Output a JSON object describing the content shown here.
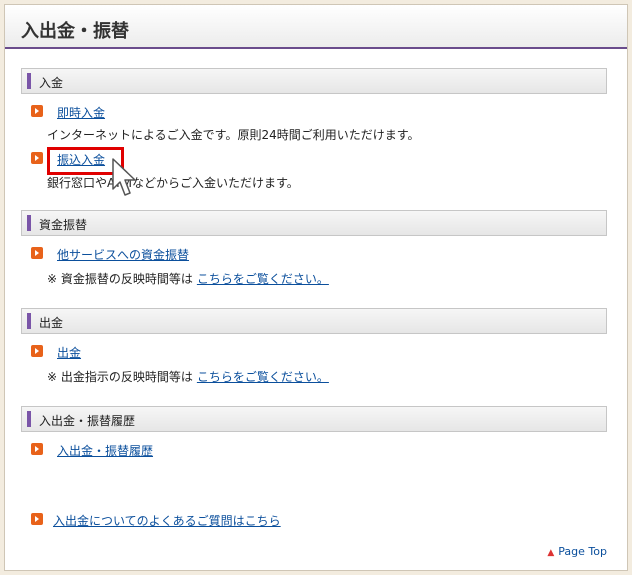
{
  "header": {
    "title": "入出金・振替"
  },
  "sections": [
    {
      "title": "入金"
    },
    {
      "title": "資金振替"
    },
    {
      "title": "出金"
    },
    {
      "title": "入出金・振替履歴"
    }
  ],
  "deposit": {
    "instant_link": "即時入金",
    "instant_desc": "インターネットによるご入金です。原則24時間ご利用いただけます。",
    "transfer_link": "振込入金",
    "transfer_desc": "銀行窓口やATMなどからご入金いただけます。"
  },
  "transfer": {
    "link": "他サービスへの資金振替",
    "note": "※ 資金振替の反映時間等は",
    "note_link": "こちらをご覧ください。"
  },
  "withdraw": {
    "link": "出金",
    "note": "※ 出金指示の反映時間等は",
    "note_link": "こちらをご覧ください。"
  },
  "history": {
    "link": "入出金・振替履歴"
  },
  "faq": {
    "link": "入出金についてのよくあるご質問はこちら"
  },
  "footer": {
    "pagetop": "Page Top"
  },
  "colors": {
    "accent": "#7a55a8",
    "link": "#0b4f9c",
    "bullet": "#e8621a",
    "highlight": "#e00000"
  }
}
